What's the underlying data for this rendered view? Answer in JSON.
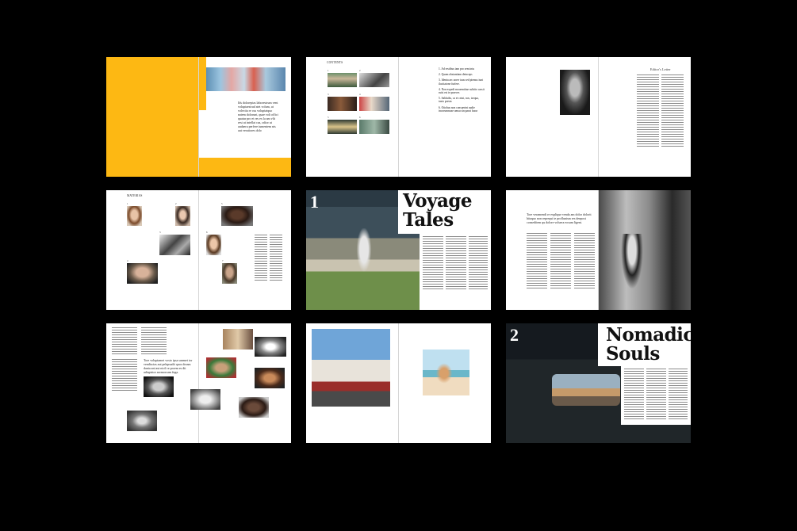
{
  "spread1": {
    "intro": "Ids doloreptas laborestrum vent voluptaestrud atet volum, ut volectia re cus voluptatquo natem dolorunt, quae volt offici quatur pro et res ex la am vlit rest ut intellat cus, odior ut audaeru perfere iumentem nis aut veratiores dolo"
  },
  "spread2": {
    "heading": "CONTENTS",
    "thumb_numbers": [
      "1",
      "2",
      "3",
      "4",
      "5",
      "6"
    ],
    "toc": [
      "1. Ad restibus iam pro sem intu",
      "2. Quam obstantiam deinceps",
      "3. Identa arc aorer iuus sed pirmus iunt ilucitatone furfere.",
      "4. Non expedi mooemtitae subtito cassit ruisi est te praeces",
      "5. Salduibs, ca et cetat, nos, torqua, iusto presta",
      "6. Otiohus non consuerint audie incorumnuxe umsu sin parat fusur"
    ]
  },
  "spread3": {
    "heading": "Editor's Letter"
  },
  "spread4": {
    "heading": "MATERIAS",
    "numbers": [
      "1",
      "2",
      "3",
      "4",
      "5",
      "6",
      "7"
    ]
  },
  "spread5": {
    "number": "1",
    "title_line1": "Voyage",
    "title_line2": "Tales"
  },
  "spread6": {
    "intro": "Tore veramendi re explique venda am dolor dolorit hitaquo non reprequi te proflunism res denpost conseditem qu dolore voluera eosum ligent."
  },
  "spread7": {
    "quote": "Tore voluptamet vosto ipsa sunmet tor vendiscias aut pelapsadit quos dossm dania ani aut nicil re proem es dit adiapistor aormorcam fuga."
  },
  "spread9": {
    "number": "2",
    "title_line1": "Nomadic",
    "title_line2": "Souls"
  },
  "colors": {
    "background": "#000000",
    "accent_yellow": "#FDB813",
    "page": "#FFFFFF"
  }
}
